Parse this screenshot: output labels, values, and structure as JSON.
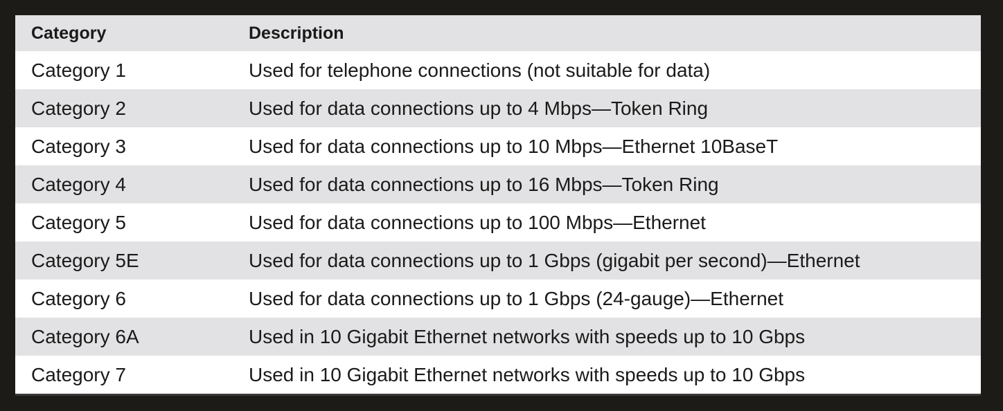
{
  "table": {
    "headers": {
      "category": "Category",
      "description": "Description"
    },
    "rows": [
      {
        "category": "Category 1",
        "description": "Used for telephone connections (not suitable for data)"
      },
      {
        "category": "Category 2",
        "description": "Used for data connections up to 4 Mbps—Token Ring"
      },
      {
        "category": "Category 3",
        "description": "Used for data connections up to 10 Mbps—Ethernet 10BaseT"
      },
      {
        "category": "Category 4",
        "description": "Used for data connections up to 16 Mbps—Token Ring"
      },
      {
        "category": "Category 5",
        "description": "Used for data connections up to 100 Mbps—Ethernet"
      },
      {
        "category": "Category 5E",
        "description": "Used for data connections up to 1 Gbps (gigabit per second)—Ethernet"
      },
      {
        "category": "Category 6",
        "description": "Used for data connections up to 1 Gbps (24-gauge)—Ethernet"
      },
      {
        "category": "Category 6A",
        "description": "Used in 10 Gigabit Ethernet networks with speeds up to 10 Gbps"
      },
      {
        "category": "Category 7",
        "description": "Used in 10 Gigabit Ethernet networks with speeds up to 10 Gbps"
      }
    ]
  }
}
